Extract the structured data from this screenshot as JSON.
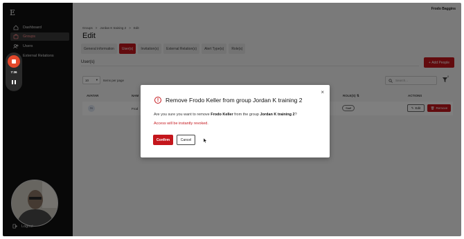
{
  "app": {
    "logo": "E"
  },
  "sidebar": {
    "items": [
      {
        "label": "Dashboard",
        "icon": "home-icon"
      },
      {
        "label": "Groups",
        "icon": "groups-icon",
        "active": true
      },
      {
        "label": "Users",
        "icon": "users-icon"
      },
      {
        "label": "External Relations",
        "icon": "relations-icon"
      }
    ],
    "logout": "Logout"
  },
  "recorder": {
    "time": "7:36"
  },
  "header": {
    "user_name": "Frodo Baggins"
  },
  "breadcrumb": [
    "Groups",
    ">",
    "Jordan K training 2",
    ">",
    "Edit"
  ],
  "page": {
    "title": "Edit"
  },
  "tabs": [
    {
      "label": "General information"
    },
    {
      "label": "User(s)",
      "active": true
    },
    {
      "label": "Invitation(s)"
    },
    {
      "label": "External Relation(s)"
    },
    {
      "label": "Alert Type(s)"
    },
    {
      "label": "Role(s)"
    }
  ],
  "section": {
    "title": "User(s)",
    "add_button": "Add People"
  },
  "controls": {
    "per_page_value": "10",
    "per_page_label": "Items per page",
    "search_placeholder": "Search...",
    "filter_count": "0"
  },
  "table": {
    "headers": {
      "avatar": "AVATAR",
      "name": "NAM",
      "roles": "ROLE(S)",
      "actions": "ACTIONS"
    },
    "rows": [
      {
        "avatar": "FK",
        "name": "Frod",
        "role": "Staff",
        "edit": "Edit",
        "remove": "Remove"
      }
    ]
  },
  "modal": {
    "title": "Remove Frodo Keller from group Jordan K training 2",
    "msg_prefix": "Are you sure you want to remove ",
    "msg_user": "Frodo Keller",
    "msg_middle": " from the group ",
    "msg_group": "Jordan K training 2",
    "msg_suffix": "?",
    "warning": "Access will be instantly revoked.",
    "confirm": "Confirm",
    "cancel": "Cancel",
    "close": "×",
    "alert": "!"
  },
  "colors": {
    "accent": "#c4161c",
    "sidebar": "#111111"
  }
}
